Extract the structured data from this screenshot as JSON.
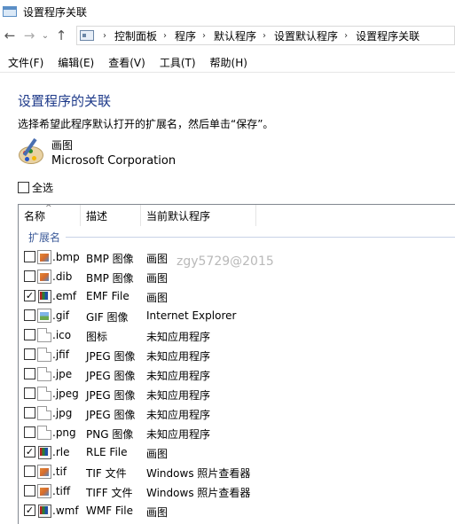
{
  "window": {
    "title": "设置程序关联"
  },
  "nav": {
    "address": [
      "控制面板",
      "程序",
      "默认程序",
      "设置默认程序",
      "设置程序关联"
    ]
  },
  "menu": [
    "文件(F)",
    "编辑(E)",
    "查看(V)",
    "工具(T)",
    "帮助(H)"
  ],
  "page": {
    "title": "设置程序的关联",
    "description": "选择希望此程序默认打开的扩展名，然后单击“保存”。",
    "program_name": "画图",
    "program_vendor": "Microsoft Corporation",
    "select_all_label": "全选",
    "select_all_checked": false
  },
  "list": {
    "columns": [
      "名称",
      "描述",
      "当前默认程序"
    ],
    "group": "扩展名",
    "rows": [
      {
        "ext": ".bmp",
        "desc": "BMP 图像",
        "prog": "画图",
        "checked": false,
        "icon": "paint-file-icon"
      },
      {
        "ext": ".dib",
        "desc": "BMP 图像",
        "prog": "画图",
        "checked": false,
        "icon": "paint-file-icon"
      },
      {
        "ext": ".emf",
        "desc": "EMF File",
        "prog": "画图",
        "checked": true,
        "icon": "metafile-icon"
      },
      {
        "ext": ".gif",
        "desc": "GIF 图像",
        "prog": "Internet Explorer",
        "checked": false,
        "icon": "gif-file-icon"
      },
      {
        "ext": ".ico",
        "desc": "图标",
        "prog": "未知应用程序",
        "checked": false,
        "icon": "blank-file-icon"
      },
      {
        "ext": ".jfif",
        "desc": "JPEG 图像",
        "prog": "未知应用程序",
        "checked": false,
        "icon": "blank-file-icon"
      },
      {
        "ext": ".jpe",
        "desc": "JPEG 图像",
        "prog": "未知应用程序",
        "checked": false,
        "icon": "blank-file-icon"
      },
      {
        "ext": ".jpeg",
        "desc": "JPEG 图像",
        "prog": "未知应用程序",
        "checked": false,
        "icon": "blank-file-icon"
      },
      {
        "ext": ".jpg",
        "desc": "JPEG 图像",
        "prog": "未知应用程序",
        "checked": false,
        "icon": "blank-file-icon"
      },
      {
        "ext": ".png",
        "desc": "PNG 图像",
        "prog": "未知应用程序",
        "checked": false,
        "icon": "blank-file-icon"
      },
      {
        "ext": ".rle",
        "desc": "RLE File",
        "prog": "画图",
        "checked": true,
        "icon": "metafile-icon"
      },
      {
        "ext": ".tif",
        "desc": "TIF 文件",
        "prog": "Windows 照片查看器",
        "checked": false,
        "icon": "paint-file-icon"
      },
      {
        "ext": ".tiff",
        "desc": "TIFF 文件",
        "prog": "Windows 照片查看器",
        "checked": false,
        "icon": "paint-file-icon"
      },
      {
        "ext": ".wmf",
        "desc": "WMF File",
        "prog": "画图",
        "checked": true,
        "icon": "metafile-icon"
      }
    ]
  },
  "watermark": "zgy5729@2015"
}
